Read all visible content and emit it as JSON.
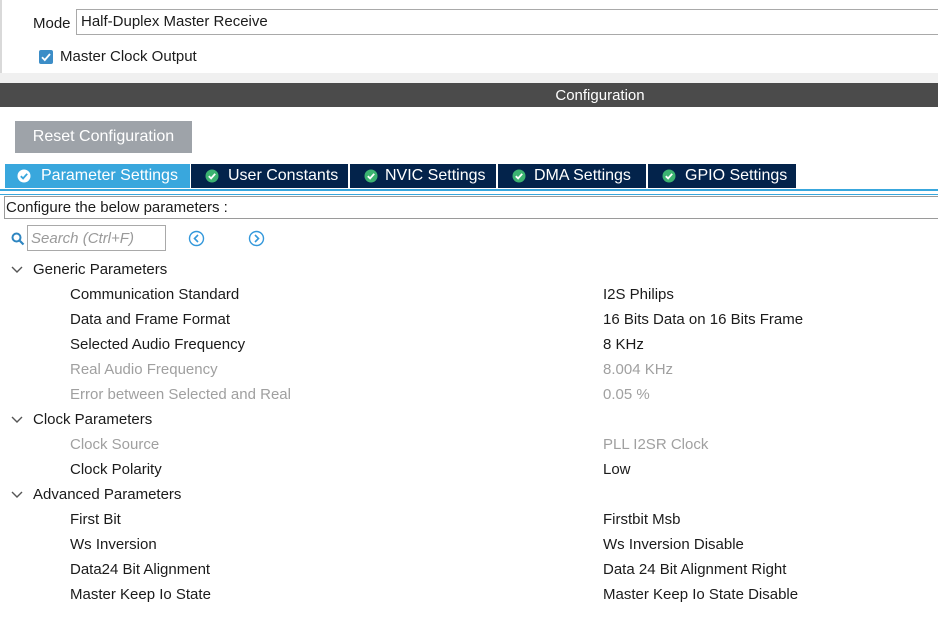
{
  "mode": {
    "label": "Mode",
    "value": "Half-Duplex Master Receive"
  },
  "master_clock_output": {
    "label": "Master Clock Output",
    "checked": true
  },
  "configuration": {
    "title": "Configuration"
  },
  "reset_button": {
    "label": "Reset Configuration"
  },
  "tabs": [
    {
      "label": "Parameter Settings",
      "active": true
    },
    {
      "label": "User Constants",
      "active": false
    },
    {
      "label": "NVIC Settings",
      "active": false
    },
    {
      "label": "DMA Settings",
      "active": false
    },
    {
      "label": "GPIO Settings",
      "active": false
    }
  ],
  "configure_text": "Configure the below parameters :",
  "search": {
    "placeholder": "Search (Ctrl+F)"
  },
  "groups": [
    {
      "label": "Generic Parameters",
      "params": [
        {
          "name": "Communication Standard",
          "value": "I2S Philips",
          "enabled": true
        },
        {
          "name": "Data and Frame Format",
          "value": "16 Bits Data on 16 Bits Frame",
          "enabled": true
        },
        {
          "name": "Selected Audio Frequency",
          "value": "8 KHz",
          "enabled": true
        },
        {
          "name": "Real Audio Frequency",
          "value": "8.004 KHz",
          "enabled": false
        },
        {
          "name": "Error between Selected and Real",
          "value": "0.05 %",
          "enabled": false
        }
      ]
    },
    {
      "label": "Clock Parameters",
      "params": [
        {
          "name": "Clock Source",
          "value": "PLL I2SR Clock",
          "enabled": false
        },
        {
          "name": "Clock Polarity",
          "value": "Low",
          "enabled": true
        }
      ]
    },
    {
      "label": "Advanced Parameters",
      "params": [
        {
          "name": "First Bit",
          "value": "Firstbit Msb",
          "enabled": true
        },
        {
          "name": "Ws Inversion",
          "value": "Ws Inversion Disable",
          "enabled": true
        },
        {
          "name": "Data24 Bit Alignment",
          "value": "Data 24 Bit Alignment Right",
          "enabled": true
        },
        {
          "name": "Master Keep Io State",
          "value": "Master Keep Io State Disable",
          "enabled": true
        }
      ]
    }
  ],
  "colors": {
    "tab_active": "#39a7dd",
    "tab_inactive": "#03234b",
    "tab_check": "#3cb371",
    "header_bar": "#4b4b4b",
    "disabled_text": "#a0a0a0"
  }
}
